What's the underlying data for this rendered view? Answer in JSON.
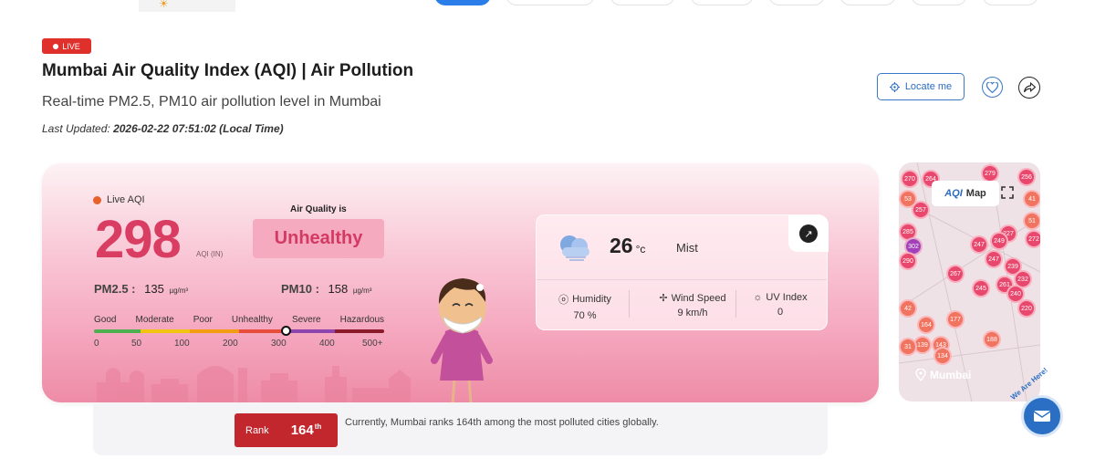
{
  "header": {
    "live_badge": "LIVE",
    "title": "Mumbai Air Quality Index (AQI) | Air Pollution",
    "subtitle": "Real-time PM2.5, PM10 air pollution level in Mumbai",
    "last_updated_label": "Last Updated:",
    "last_updated_value": "2026-02-22 07:51:02 (Local Time)",
    "locate_label": "Locate me"
  },
  "aqi": {
    "live_label": "Live AQI",
    "value": "298",
    "unit": "AQI (IN)",
    "air_quality_label": "Air Quality is",
    "status": "Unhealthy",
    "pm25_label": "PM2.5 :",
    "pm25_value": "135",
    "pm25_unit": "µg/m³",
    "pm10_label": "PM10 :",
    "pm10_value": "158",
    "pm10_unit": "µg/m³",
    "scale_labels": [
      "Good",
      "Moderate",
      "Poor",
      "Unhealthy",
      "Severe",
      "Hazardous"
    ],
    "scale_numbers": [
      "0",
      "50",
      "100",
      "200",
      "300",
      "400",
      "500+"
    ],
    "scale_colors": [
      "#4caf50",
      "#f1c40f",
      "#f39c12",
      "#e74c3c",
      "#8e44ad",
      "#8b1a2b"
    ]
  },
  "weather": {
    "temperature": "26",
    "temperature_unit": "°c",
    "condition": "Mist",
    "humidity_label": "Humidity",
    "humidity_value": "70 %",
    "wind_label": "Wind Speed",
    "wind_value": "9 km/h",
    "uv_label": "UV Index",
    "uv_value": "0"
  },
  "rank": {
    "label": "Rank",
    "value": "164",
    "suffix": "th",
    "text": "Currently, Mumbai ranks 164th among the most polluted cities globally."
  },
  "map": {
    "logo": "AQI",
    "title": "Map",
    "city": "Mumbai",
    "markers": [
      "270",
      "264",
      "279",
      "256",
      "257",
      "285",
      "302",
      "290",
      "227",
      "247",
      "249",
      "272",
      "247",
      "239",
      "267",
      "245",
      "261",
      "240",
      "232",
      "220",
      "164",
      "177",
      "139",
      "143",
      "134",
      "188",
      "42",
      "53",
      "41",
      "51",
      "31"
    ]
  },
  "chat": {
    "label": "We Are Here!"
  }
}
